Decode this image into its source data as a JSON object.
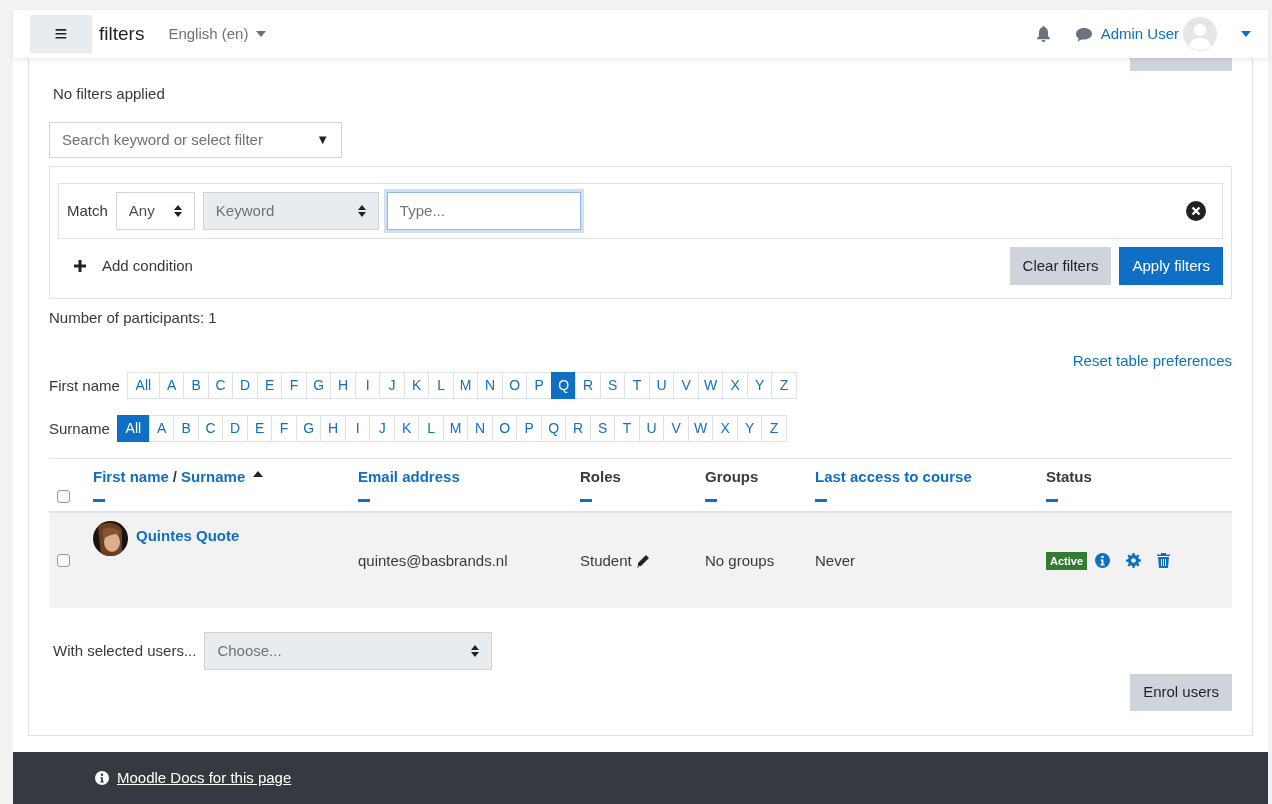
{
  "navbar": {
    "menu_button": "≡",
    "title": "filters",
    "language": "English (en)",
    "user": "Admin User"
  },
  "filter_status": "No filters applied",
  "filter_search": {
    "placeholder": "Search keyword or select filter",
    "arrow": "▼"
  },
  "condition": {
    "match_label": "Match",
    "match_value": "Any",
    "type_value": "Keyword",
    "type_disabled": true,
    "input_placeholder": "Type..."
  },
  "add_condition": "Add condition",
  "filter_buttons": [
    {
      "label": "Clear filters",
      "kind": "secondary"
    },
    {
      "label": "Apply filters",
      "kind": "primary"
    }
  ],
  "participants_count": "Number of participants: 1",
  "reset_link": "Reset table preferences",
  "initials": [
    {
      "label": "First name",
      "letters": [
        {
          "text": "All",
          "selected": false
        },
        {
          "text": "A",
          "selected": false
        },
        {
          "text": "B",
          "selected": false
        },
        {
          "text": "C",
          "selected": false
        },
        {
          "text": "D",
          "selected": false
        },
        {
          "text": "E",
          "selected": false
        },
        {
          "text": "F",
          "selected": false
        },
        {
          "text": "G",
          "selected": false
        },
        {
          "text": "H",
          "selected": false
        },
        {
          "text": "I",
          "selected": false
        },
        {
          "text": "J",
          "selected": false
        },
        {
          "text": "K",
          "selected": false
        },
        {
          "text": "L",
          "selected": false
        },
        {
          "text": "M",
          "selected": false
        },
        {
          "text": "N",
          "selected": false
        },
        {
          "text": "O",
          "selected": false
        },
        {
          "text": "P",
          "selected": false
        },
        {
          "text": "Q",
          "selected": true
        },
        {
          "text": "R",
          "selected": false
        },
        {
          "text": "S",
          "selected": false
        },
        {
          "text": "T",
          "selected": false
        },
        {
          "text": "U",
          "selected": false
        },
        {
          "text": "V",
          "selected": false
        },
        {
          "text": "W",
          "selected": false
        },
        {
          "text": "X",
          "selected": false
        },
        {
          "text": "Y",
          "selected": false
        },
        {
          "text": "Z",
          "selected": false
        }
      ]
    },
    {
      "label": "Surname",
      "letters": [
        {
          "text": "All",
          "selected": true
        },
        {
          "text": "A",
          "selected": false
        },
        {
          "text": "B",
          "selected": false
        },
        {
          "text": "C",
          "selected": false
        },
        {
          "text": "D",
          "selected": false
        },
        {
          "text": "E",
          "selected": false
        },
        {
          "text": "F",
          "selected": false
        },
        {
          "text": "G",
          "selected": false
        },
        {
          "text": "H",
          "selected": false
        },
        {
          "text": "I",
          "selected": false
        },
        {
          "text": "J",
          "selected": false
        },
        {
          "text": "K",
          "selected": false
        },
        {
          "text": "L",
          "selected": false
        },
        {
          "text": "M",
          "selected": false
        },
        {
          "text": "N",
          "selected": false
        },
        {
          "text": "O",
          "selected": false
        },
        {
          "text": "P",
          "selected": false
        },
        {
          "text": "Q",
          "selected": false
        },
        {
          "text": "R",
          "selected": false
        },
        {
          "text": "S",
          "selected": false
        },
        {
          "text": "T",
          "selected": false
        },
        {
          "text": "U",
          "selected": false
        },
        {
          "text": "V",
          "selected": false
        },
        {
          "text": "W",
          "selected": false
        },
        {
          "text": "X",
          "selected": false
        },
        {
          "text": "Y",
          "selected": false
        },
        {
          "text": "Z",
          "selected": false
        }
      ]
    }
  ],
  "table": {
    "select_all_checked": false,
    "columns": [
      {
        "parts": [
          "First name",
          "Surname"
        ],
        "separator": "/",
        "link": true,
        "sorted_ascending": true
      },
      {
        "parts": [
          "Email address"
        ],
        "link": true
      },
      {
        "parts": [
          "Roles"
        ],
        "link": false
      },
      {
        "parts": [
          "Groups"
        ],
        "link": false
      },
      {
        "parts": [
          "Last access to course"
        ],
        "link": true
      },
      {
        "parts": [
          "Status"
        ],
        "link": false
      }
    ],
    "rows": [
      {
        "checked": false,
        "name": "Quintes Quote",
        "email": "quintes@basbrands.nl",
        "roles": "Student",
        "groups": "No groups",
        "last_access": "Never",
        "status": "Active"
      }
    ]
  },
  "bulk": {
    "label": "With selected users...",
    "placeholder": "Choose..."
  },
  "bottom_button": "Enrol users",
  "footer_link": "Moodle Docs for this page"
}
